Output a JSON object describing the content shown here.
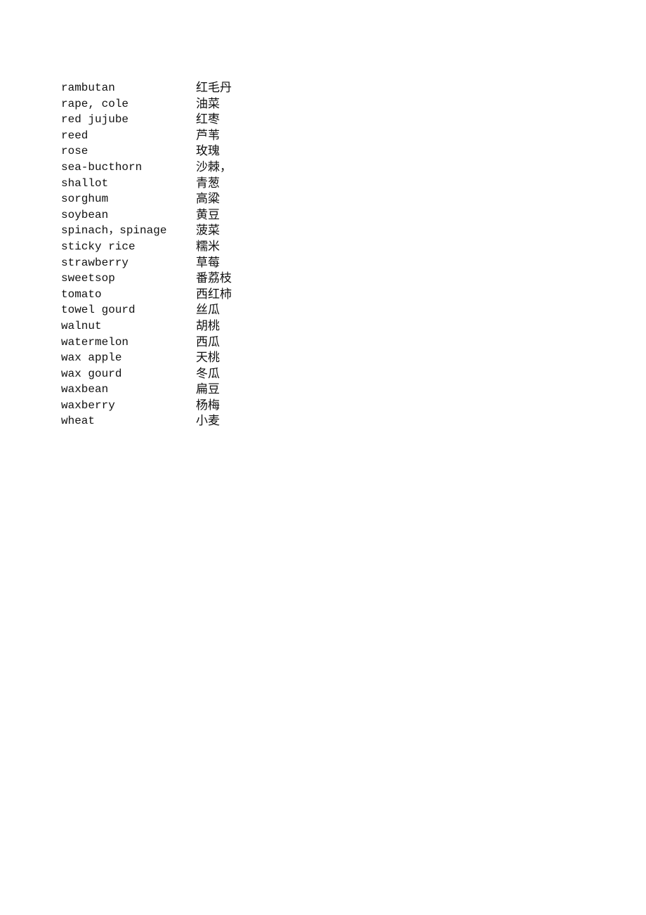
{
  "vocabulary": [
    {
      "en": "rambutan",
      "zh": "红毛丹"
    },
    {
      "en": "rape, cole",
      "zh": "油菜"
    },
    {
      "en": "red jujube",
      "zh": "红枣"
    },
    {
      "en": "reed",
      "zh": "芦苇"
    },
    {
      "en": "rose",
      "zh": "玫瑰"
    },
    {
      "en": "sea-bucthorn",
      "zh": "沙棘，"
    },
    {
      "en": "shallot",
      "zh": "青葱"
    },
    {
      "en": "sorghum",
      "zh": "高粱"
    },
    {
      "en": "soybean",
      "zh": "黄豆"
    },
    {
      "en": "spinach，spinage",
      "zh": "菠菜"
    },
    {
      "en": "sticky rice",
      "zh": "糯米"
    },
    {
      "en": "strawberry",
      "zh": "草莓"
    },
    {
      "en": "sweetsop",
      "zh": "番荔枝"
    },
    {
      "en": "tomato",
      "zh": "西红柿"
    },
    {
      "en": "towel gourd",
      "zh": "丝瓜"
    },
    {
      "en": "walnut",
      "zh": "胡桃"
    },
    {
      "en": "watermelon",
      "zh": "西瓜"
    },
    {
      "en": "wax apple",
      "zh": "天桃"
    },
    {
      "en": "wax gourd",
      "zh": "冬瓜"
    },
    {
      "en": "waxbean",
      "zh": "扁豆"
    },
    {
      "en": "waxberry",
      "zh": "杨梅"
    },
    {
      "en": "wheat",
      "zh": "小麦"
    }
  ]
}
